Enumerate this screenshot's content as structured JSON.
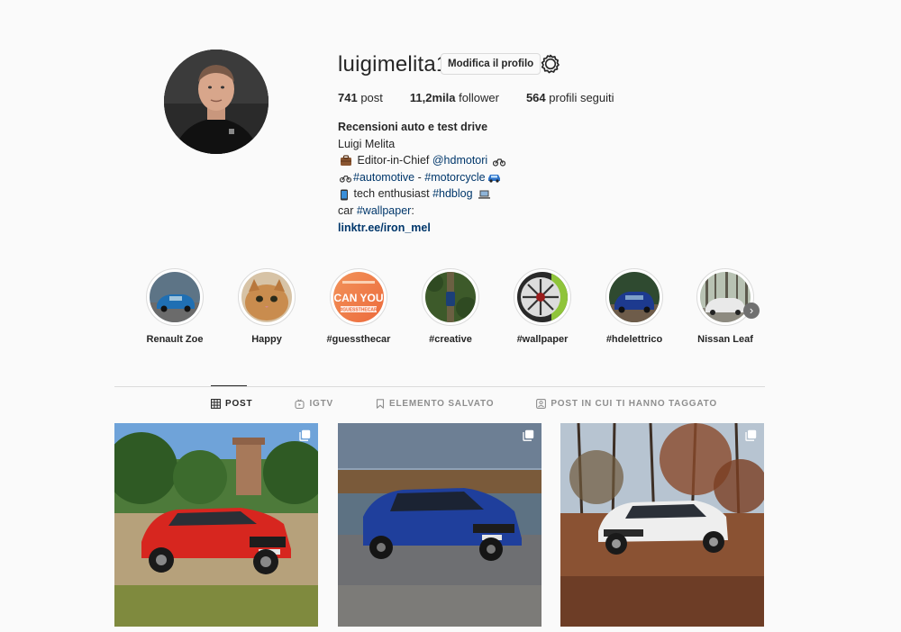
{
  "profile": {
    "username": "luigimelita1",
    "edit_button": "Modifica il profilo",
    "stats": {
      "posts_value": "741",
      "posts_label": "post",
      "followers_value": "11,2mila",
      "followers_label": "follower",
      "following_value": "564",
      "following_label": "profili seguiti"
    },
    "bio": {
      "title": "Recensioni auto e test drive",
      "name": "Luigi Melita",
      "line1_text": "Editor-in-Chief",
      "line1_tag": "@hdmotori",
      "line2_tag1": "#automotive",
      "line2_sep": "-",
      "line2_tag2": "#motorcycle",
      "line3_text": "tech enthusiast",
      "line3_tag": "#hdblog",
      "line4_text": "car",
      "line4_tag": "#wallpaper",
      "line4_suffix": ":",
      "link": "linktr.ee/iron_mel"
    }
  },
  "highlights": [
    {
      "label": "Renault Zoe"
    },
    {
      "label": "Happy"
    },
    {
      "label": "#guessthecar",
      "image_text": "CAN YOU",
      "image_sub": "#GUESSTHECAR"
    },
    {
      "label": "#creative"
    },
    {
      "label": "#wallpaper"
    },
    {
      "label": "#hdelettrico"
    },
    {
      "label": "Nissan Leaf"
    }
  ],
  "tabs": [
    {
      "label": "POST",
      "icon": "grid-icon",
      "active": true
    },
    {
      "label": "IGTV",
      "icon": "igtv-icon",
      "active": false
    },
    {
      "label": "ELEMENTO SALVATO",
      "icon": "bookmark-icon",
      "active": false
    },
    {
      "label": "POST IN CUI TI HANNO TAGGATO",
      "icon": "tagged-icon",
      "active": false
    }
  ],
  "posts": [
    {
      "subject": "red-suv-castle",
      "multi": true
    },
    {
      "subject": "blue-hatchback-lake",
      "multi": true
    },
    {
      "subject": "white-suv-forest",
      "multi": true
    }
  ],
  "colors": {
    "link": "#00376b",
    "border": "#dbdbdb",
    "text": "#262626",
    "muted": "#8e8e8e",
    "background": "#fafafa"
  }
}
